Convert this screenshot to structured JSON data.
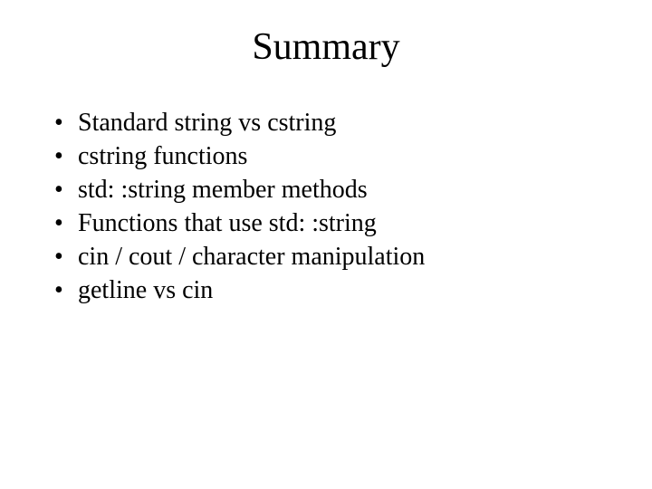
{
  "slide": {
    "title": "Summary",
    "bullets": [
      "Standard string vs cstring",
      "cstring functions",
      "std: :string member methods",
      "Functions that use std: :string",
      "cin / cout  / character manipulation",
      "getline vs cin"
    ]
  }
}
